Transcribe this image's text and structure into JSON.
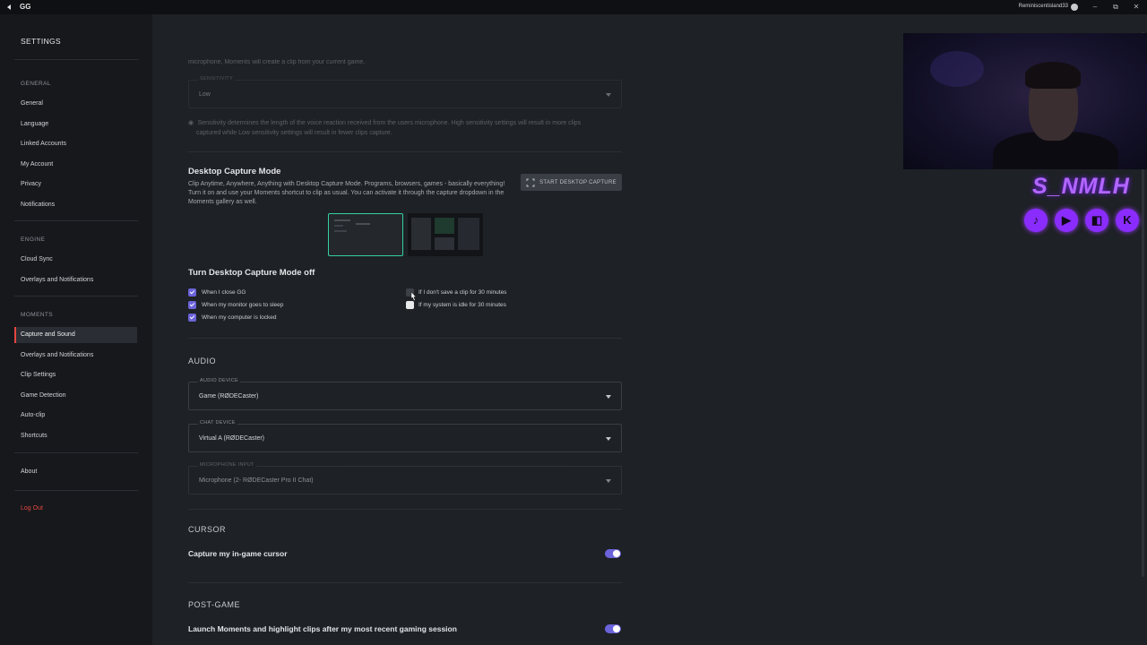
{
  "titlebar": {
    "app_name": "GG",
    "username": "Reminiscentisland33",
    "minimize": "–",
    "restore": "⧉",
    "close": "✕"
  },
  "sidebar": {
    "title": "SETTINGS",
    "sections": {
      "general": "GENERAL",
      "engine": "ENGINE",
      "moments": "MOMENTS"
    },
    "items": {
      "general": "General",
      "language": "Language",
      "linked_accounts": "Linked Accounts",
      "my_account": "My Account",
      "privacy": "Privacy",
      "notifications": "Notifications",
      "cloud_sync": "Cloud Sync",
      "overlays_engine": "Overlays and Notifications",
      "capture_sound": "Capture and Sound",
      "overlays_moments": "Overlays and Notifications",
      "clip_settings": "Clip Settings",
      "game_detection": "Game Detection",
      "auto_clip": "Auto-clip",
      "shortcuts": "Shortcuts",
      "about": "About",
      "log_out": "Log Out"
    },
    "active_item": "Capture and Sound",
    "accent_color": "#e5463f"
  },
  "voice": {
    "intro_text": "microphone, Moments will create a clip from your current game.",
    "sensitivity_label": "SENSITIVITY",
    "sensitivity_value": "Low",
    "sensitivity_note": "Sensitivity determines the length of the voice reaction received from the users microphone. High sensitivity settings will result in more clips",
    "sensitivity_note2": "captured while Low sensitivity settings will result in fewer clips capture."
  },
  "desktop_capture": {
    "title": "Desktop Capture Mode",
    "description": "Clip Anytime, Anywhere, Anything with Desktop Capture Mode. Programs, browsers, games - basically everything! Turn it on and use your Moments shortcut to clip as usual. You can activate it through the capture dropdown in the Moments gallery as well.",
    "button_label": "START DESKTOP CAPTURE",
    "off_title": "Turn Desktop Capture Mode off",
    "options": {
      "close_gg": "When I close GG",
      "monitor_sleep": "When my monitor goes to sleep",
      "computer_locked": "When my computer is locked",
      "no_clip_30": "If I don't save a clip for 30 minutes",
      "idle_30": "If my system is idle for 30 minutes"
    }
  },
  "audio": {
    "section": "AUDIO",
    "audio_device_label": "AUDIO DEVICE",
    "audio_device_value": "Game (RØDECaster)",
    "chat_device_label": "CHAT DEVICE",
    "chat_device_value": "Virtual A (RØDECaster)",
    "mic_label": "MICROPHONE INPUT",
    "mic_value": "Microphone (2- RØDECaster Pro II Chat)"
  },
  "cursor": {
    "section": "CURSOR",
    "capture_cursor": "Capture my in-game cursor"
  },
  "post_game": {
    "section": "POST-GAME",
    "launch_moments": "Launch Moments and highlight clips after my most recent gaming session"
  },
  "overlay": {
    "brand": "S_NMLH",
    "socials": [
      "♪",
      "▶",
      "◧",
      "K"
    ],
    "brand_color": "#b266ff"
  },
  "colors": {
    "checkbox": "#6b63d9",
    "toggle": "#6b63d9",
    "thumb_border": "#33d0a5"
  }
}
